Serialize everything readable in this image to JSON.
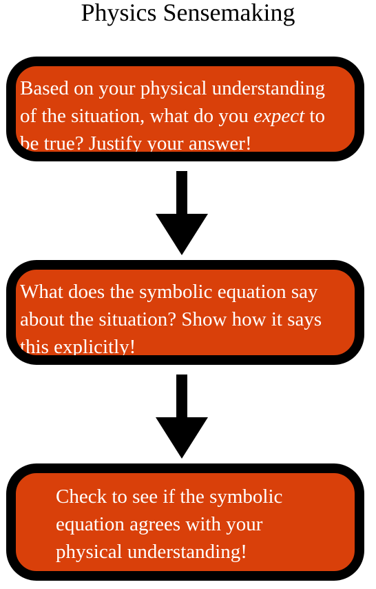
{
  "title": "Physics Sensemaking",
  "steps": [
    {
      "lines": [
        "Based on your physical understanding",
        "of the situation, what do you ",
        "expect",
        " to",
        "be true?  Justify your answer!"
      ]
    },
    {
      "lines": [
        "What does the symbolic equation say",
        "about the situation?  Show how it says",
        "this explicitly!"
      ]
    },
    {
      "lines": [
        "Check to see if the symbolic",
        "equation agrees with your",
        "physical understanding!"
      ]
    }
  ],
  "colors": {
    "box_fill": "#d9400a",
    "box_border": "#000000",
    "text": "#ffffff",
    "arrow": "#000000"
  },
  "icons": [
    "arrow-down-icon",
    "arrow-down-icon"
  ]
}
